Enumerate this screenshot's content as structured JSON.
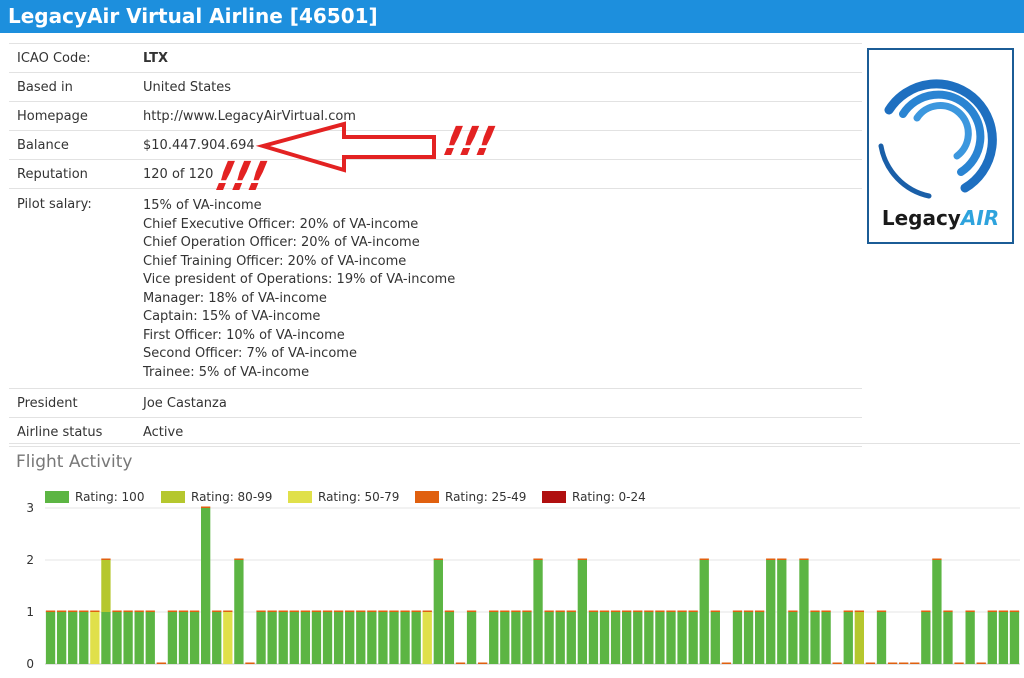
{
  "header": {
    "title": "LegacyAir Virtual Airline [46501]"
  },
  "details": {
    "icao": {
      "label": "ICAO Code:",
      "value": "LTX"
    },
    "based_in": {
      "label": "Based in",
      "value": "United States"
    },
    "homepage": {
      "label": "Homepage",
      "value": "http://www.LegacyAirVirtual.com"
    },
    "balance": {
      "label": "Balance",
      "value": "$10.447.904.694"
    },
    "reputation": {
      "label": "Reputation",
      "value": "120 of 120"
    },
    "pilot_salary": {
      "label": "Pilot salary:",
      "lines": [
        "15% of VA-income",
        "Chief Executive Officer: 20% of VA-income",
        "Chief Operation Officer: 20% of VA-income",
        "Chief Training Officer: 20% of VA-income",
        "Vice president of Operations: 19% of VA-income",
        "Manager: 18% of VA-income",
        "Captain: 15% of VA-income",
        "First Officer: 10% of VA-income",
        "Second Officer: 7% of VA-income",
        "Trainee: 5% of VA-income"
      ]
    },
    "president": {
      "label": "President",
      "value": "Joe Castanza"
    },
    "status": {
      "label": "Airline status",
      "value": "Active"
    }
  },
  "logo": {
    "word_plain": "Legacy",
    "word_accent": "AIR"
  },
  "annotation": {
    "marks_1": "!!!",
    "marks_2": "!!!",
    "color": "#e32222"
  },
  "flight_activity": {
    "title": "Flight Activity"
  },
  "chart_data": {
    "type": "bar",
    "stacked": true,
    "ylim": [
      0,
      3
    ],
    "yticks": [
      "0",
      "1",
      "2",
      "3"
    ],
    "grid": true,
    "legend_position": "top-left",
    "series": [
      {
        "name": "Rating: 100",
        "color": "#5cb543"
      },
      {
        "name": "Rating: 80-99",
        "color": "#b5c72e"
      },
      {
        "name": "Rating: 50-79",
        "color": "#e0e04a"
      },
      {
        "name": "Rating: 25-49",
        "color": "#e0600f"
      },
      {
        "name": "Rating: 0-24",
        "color": "#b00f0f"
      }
    ],
    "bars": [
      [
        1,
        0,
        0
      ],
      [
        1,
        0,
        0
      ],
      [
        1,
        0,
        0
      ],
      [
        1,
        0,
        0
      ],
      [
        0,
        0,
        1
      ],
      [
        1,
        1,
        0
      ],
      [
        1,
        0,
        0
      ],
      [
        1,
        0,
        0
      ],
      [
        1,
        0,
        0
      ],
      [
        1,
        0,
        0
      ],
      [
        0,
        0,
        0
      ],
      [
        1,
        0,
        0
      ],
      [
        1,
        0,
        0
      ],
      [
        1,
        0,
        0
      ],
      [
        3,
        0,
        0
      ],
      [
        1,
        0,
        0
      ],
      [
        0,
        0,
        1
      ],
      [
        2,
        0,
        0
      ],
      [
        0,
        0,
        0
      ],
      [
        1,
        0,
        0
      ],
      [
        1,
        0,
        0
      ],
      [
        1,
        0,
        0
      ],
      [
        1,
        0,
        0
      ],
      [
        1,
        0,
        0
      ],
      [
        1,
        0,
        0
      ],
      [
        1,
        0,
        0
      ],
      [
        1,
        0,
        0
      ],
      [
        1,
        0,
        0
      ],
      [
        1,
        0,
        0
      ],
      [
        1,
        0,
        0
      ],
      [
        1,
        0,
        0
      ],
      [
        1,
        0,
        0
      ],
      [
        1,
        0,
        0
      ],
      [
        1,
        0,
        0
      ],
      [
        0,
        0,
        1
      ],
      [
        2,
        0,
        0
      ],
      [
        1,
        0,
        0
      ],
      [
        0,
        0,
        0
      ],
      [
        1,
        0,
        0
      ],
      [
        0,
        0,
        0
      ],
      [
        1,
        0,
        0
      ],
      [
        1,
        0,
        0
      ],
      [
        1,
        0,
        0
      ],
      [
        1,
        0,
        0
      ],
      [
        2,
        0,
        0
      ],
      [
        1,
        0,
        0
      ],
      [
        1,
        0,
        0
      ],
      [
        1,
        0,
        0
      ],
      [
        2,
        0,
        0
      ],
      [
        1,
        0,
        0
      ],
      [
        1,
        0,
        0
      ],
      [
        1,
        0,
        0
      ],
      [
        1,
        0,
        0
      ],
      [
        1,
        0,
        0
      ],
      [
        1,
        0,
        0
      ],
      [
        1,
        0,
        0
      ],
      [
        1,
        0,
        0
      ],
      [
        1,
        0,
        0
      ],
      [
        1,
        0,
        0
      ],
      [
        2,
        0,
        0
      ],
      [
        1,
        0,
        0
      ],
      [
        0,
        0,
        0
      ],
      [
        1,
        0,
        0
      ],
      [
        1,
        0,
        0
      ],
      [
        1,
        0,
        0
      ],
      [
        2,
        0,
        0
      ],
      [
        2,
        0,
        0
      ],
      [
        1,
        0,
        0
      ],
      [
        2,
        0,
        0
      ],
      [
        1,
        0,
        0
      ],
      [
        1,
        0,
        0
      ],
      [
        0,
        0,
        0
      ],
      [
        1,
        0,
        0
      ],
      [
        0,
        1,
        0
      ],
      [
        0,
        0,
        0
      ],
      [
        1,
        0,
        0
      ],
      [
        0,
        0,
        0
      ],
      [
        0,
        0,
        0
      ],
      [
        0,
        0,
        0
      ],
      [
        1,
        0,
        0
      ],
      [
        2,
        0,
        0
      ],
      [
        1,
        0,
        0
      ],
      [
        0,
        0,
        0
      ],
      [
        1,
        0,
        0
      ],
      [
        0,
        0,
        0
      ],
      [
        1,
        0,
        0
      ],
      [
        1,
        0,
        0
      ],
      [
        1,
        0,
        0
      ]
    ]
  }
}
